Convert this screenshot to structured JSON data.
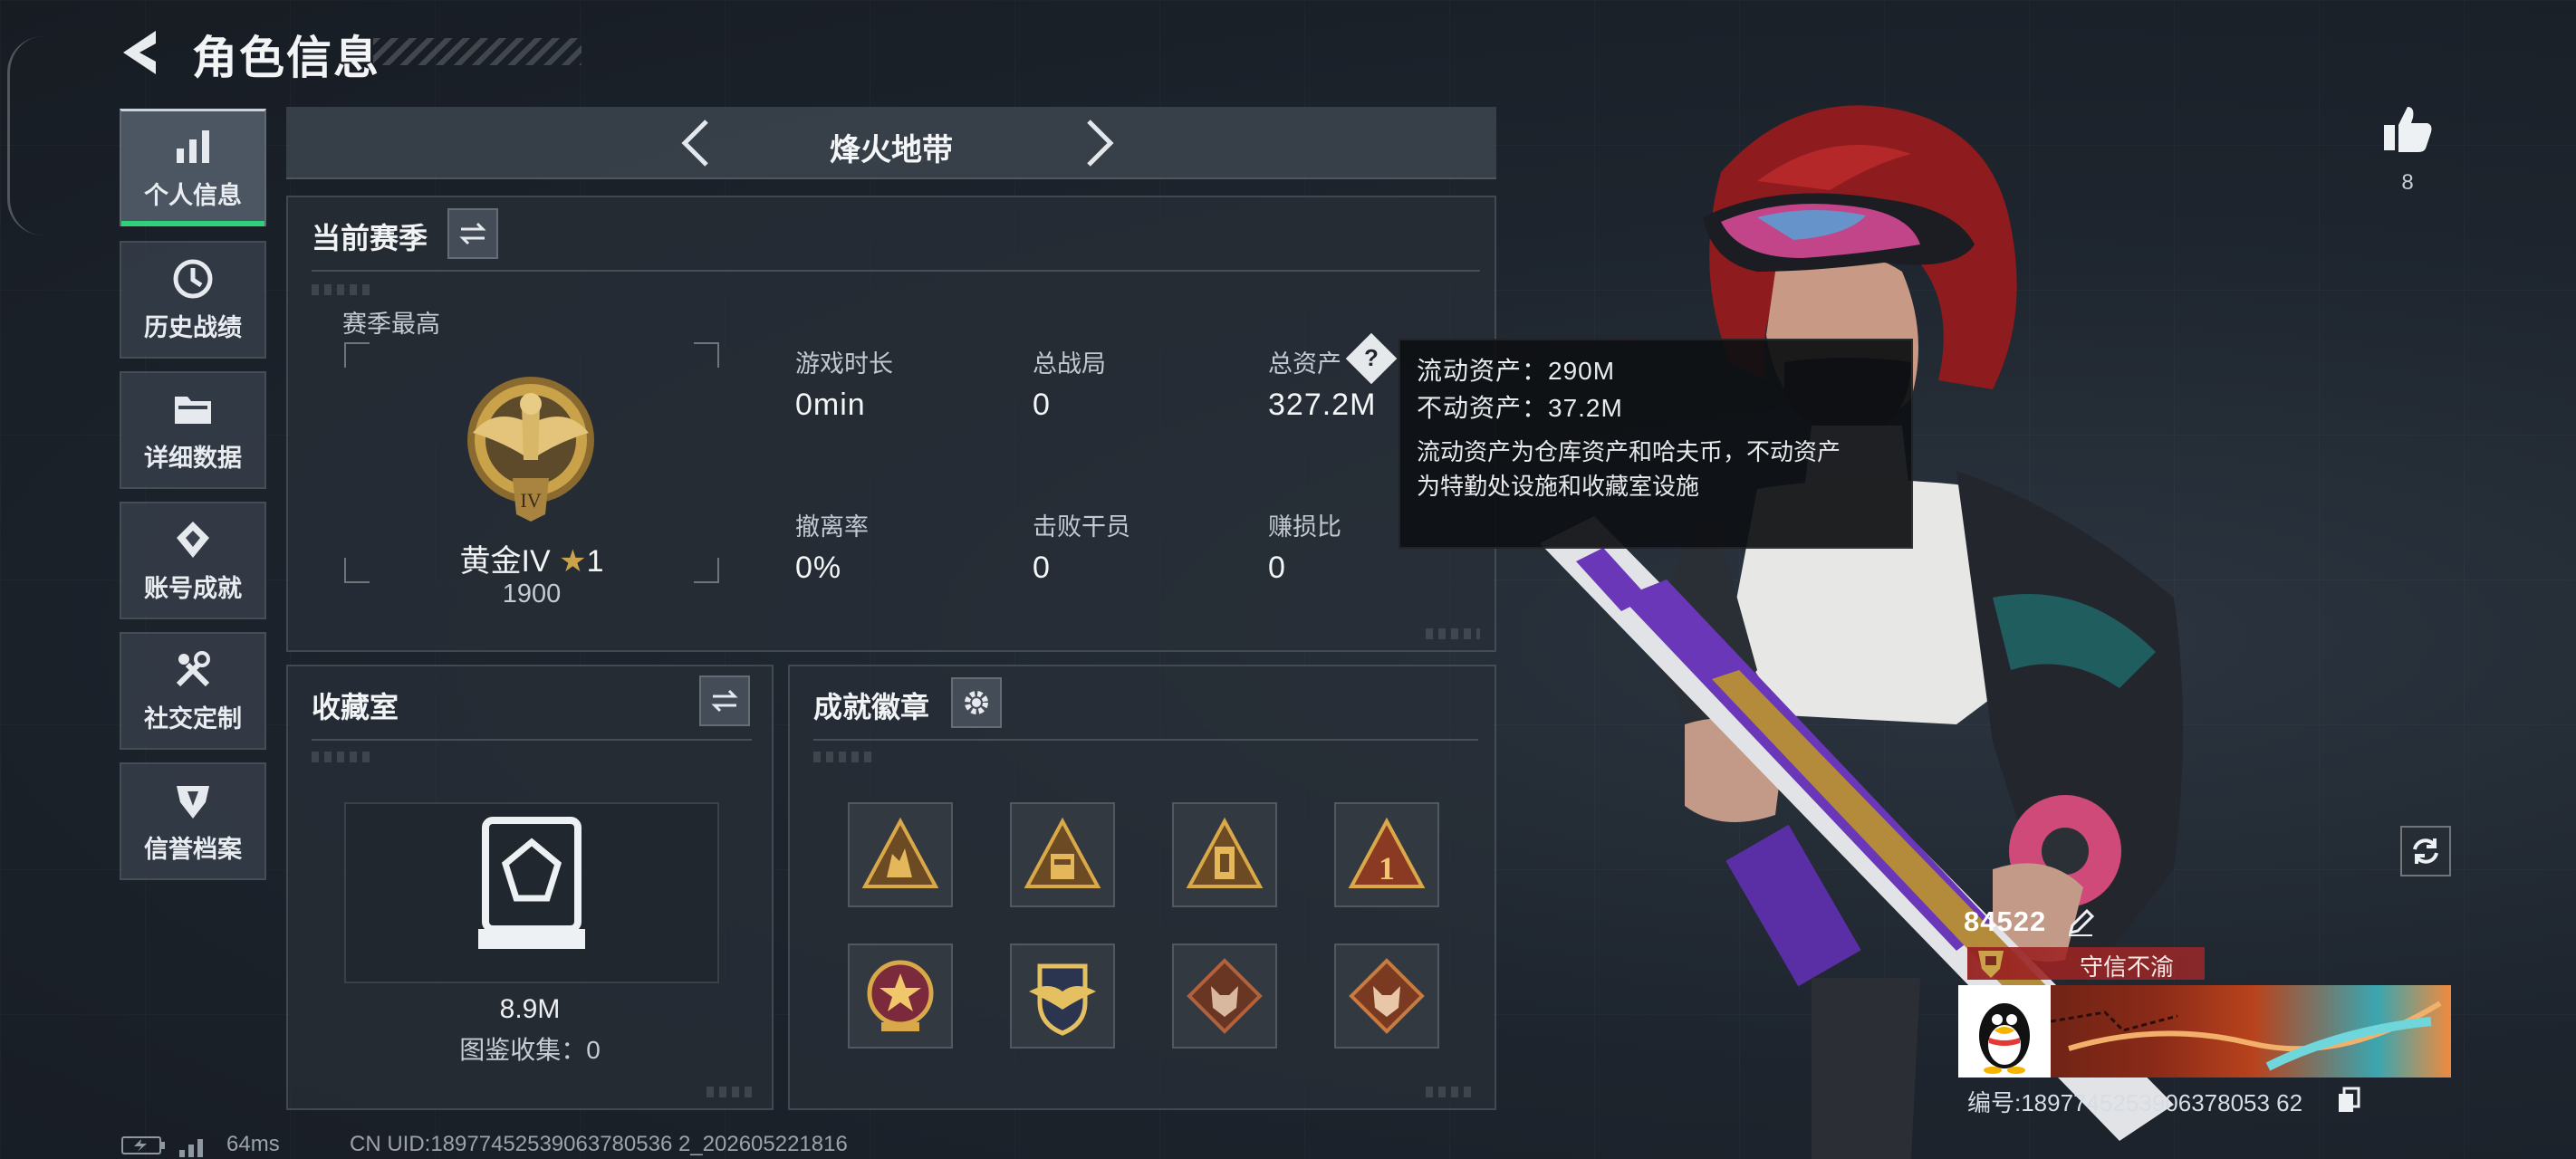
{
  "header": {
    "title": "角色信息"
  },
  "nav": {
    "items": [
      {
        "label": "个人信息",
        "icon": "bar-chart-icon",
        "active": true
      },
      {
        "label": "历史战绩",
        "icon": "clock-icon",
        "active": false
      },
      {
        "label": "详细数据",
        "icon": "folder-icon",
        "active": false
      },
      {
        "label": "账号成就",
        "icon": "achievement-icon",
        "active": false
      },
      {
        "label": "社交定制",
        "icon": "tools-icon",
        "active": false
      },
      {
        "label": "信誉档案",
        "icon": "credit-icon",
        "active": false
      }
    ]
  },
  "mode": {
    "title": "烽火地带"
  },
  "season": {
    "title": "当前赛季",
    "best_label": "赛季最高",
    "rank_name": "黄金IV",
    "rank_stars": "1",
    "rank_score": "1900",
    "stats": [
      {
        "label": "游戏时长",
        "value": "0min"
      },
      {
        "label": "总战局",
        "value": "0"
      },
      {
        "label": "总资产",
        "value": "327.2M",
        "help": "?"
      },
      {
        "label": "撤离率",
        "value": "0%"
      },
      {
        "label": "击败干员",
        "value": "0"
      },
      {
        "label": "赚损比",
        "value": "0"
      }
    ]
  },
  "tooltip": {
    "line1": "流动资产：290M",
    "line2": "不动资产：37.2M",
    "line3": "流动资产为仓库资产和哈夫币，不动资产",
    "line4": "为特勤处设施和收藏室设施"
  },
  "collection": {
    "title": "收藏室",
    "value": "8.9M",
    "count": "图鉴收集：0"
  },
  "badges": {
    "title": "成就徽章",
    "items": [
      {
        "icon": "squad-badge-icon"
      },
      {
        "icon": "armor-badge-icon"
      },
      {
        "icon": "tower-badge-icon"
      },
      {
        "icon": "number-one-badge-icon"
      },
      {
        "icon": "star-shield-badge-icon"
      },
      {
        "icon": "eagle-shield-badge-icon"
      },
      {
        "icon": "wolf-badge-icon"
      },
      {
        "icon": "wolf-gold-badge-icon"
      }
    ]
  },
  "profile": {
    "likes": "8",
    "player_id": "84522",
    "honor": "守信不渝",
    "uid_line": "编号:1897745253906378053 62"
  },
  "status": {
    "ping": "64ms",
    "uid": "CN UID:18977452539063780536 2_202605221816"
  },
  "colors": {
    "active_tab": "#2fd27a",
    "gold": "#c9a24a",
    "honor_red": "#a02828"
  }
}
